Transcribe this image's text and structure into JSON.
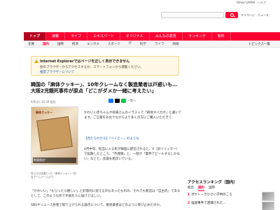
{
  "topbar": {
    "links": [
      "Yahoo! JAPAN",
      "ヘルプ"
    ]
  },
  "header": {
    "search_placeholder": "",
    "links": [
      "マイページ",
      "ニュース"
    ]
  },
  "nav": {
    "items": [
      "トップ",
      "速報",
      "ライブ",
      "エキスパート",
      "オリジナル",
      "みんなの意見",
      "ランキング",
      "有料"
    ],
    "active_index": 0
  },
  "subnav": {
    "items": [
      "主要",
      "国内",
      "国際",
      "経済",
      "エンタメ",
      "スポーツ",
      "IT",
      "科学",
      "ライフ",
      "地域"
    ],
    "active_index": 1,
    "right_label": "トピックス一覧"
  },
  "notice": {
    "title": "Internet Explorerではページを正しく表示できません",
    "body": "他のブラウザーからアクセスするか、スマートフォンから閲覧ください。",
    "link": "推奨ブラウザーについて"
  },
  "article": {
    "headline": "韓国の「麻体クッキー」、10年クレームなく製造業者は戸惑いも…大阪2児餓死事件が原点「どこがダメか一緒に考えたい」",
    "meta": "4/9(水) 16:30 配信",
    "share_label": "一覧へ",
    "photo_label": "麻体クッキー",
    "photo_sign": "数量限定！",
    "caption": "売上げも好調だった「麻体クッキー」（同店ホームページより）",
    "body1": "かわいい赤ちゃんや妊婦さんのイラストで「麻体ネバガボ」と書いてます。ご言葉をあおりながらより多くの方にご購入いただきて",
    "related": "【見たらわかる】「ベイビー」のような",
    "body2": "4月中旬、担当に入る形が韓国に配信されると、X（旧ツイッター）で拡散したところ、「不謹慎」と、一部が「業界アピールするしかない」などと、反論も相次いでいる。",
    "body3": "「かわいい」「もらったら嬉しい」と好意的に捉える声もあったものの、それでも製造は「自主的」であるとして、このような形で幸福を人に届けてほしい。",
    "body4": "SNSやニュース各者で取り上げられる論点について、販売業者はどのように受け止めたのか。"
  },
  "ranking": {
    "title": "アクセスランキング（国内）",
    "tabs": [
      "総合",
      "国内",
      "国際"
    ],
    "active_index": 1,
    "items": [
      {
        "rank": "1",
        "text": "ポケトーク小さい子供のころ"
      },
      {
        "rank": "2",
        "text": "強盗事件で逮捕された…"
      }
    ]
  }
}
